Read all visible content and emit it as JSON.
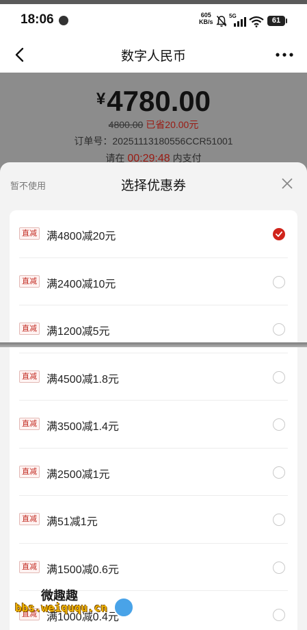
{
  "status_bar": {
    "time": "18:06",
    "net_speed_value": "605",
    "net_speed_unit": "KB/s",
    "signal_label": "5G",
    "battery": "61"
  },
  "nav": {
    "title": "数字人民币",
    "icons": [
      "back-arrow-icon",
      "more-dots-icon"
    ]
  },
  "payment": {
    "currency_symbol": "¥",
    "amount": "4780.00",
    "original_price": "4800.00",
    "saved_text": "已省20.00元",
    "order_label": "订单号：",
    "order_id": "20251113180556CCR51001",
    "countdown_prefix": "请在",
    "countdown": "00:29:48",
    "countdown_suffix": "内支付"
  },
  "coupon_sheet": {
    "skip_label": "暂不使用",
    "title": "选择优惠券",
    "close_icon": "close-icon",
    "tag_label": "直减",
    "coupons": [
      {
        "label": "满4800减20元",
        "selected": true
      },
      {
        "label": "满2400减10元",
        "selected": false
      },
      {
        "label": "满1200减5元",
        "selected": false
      },
      {
        "label": "满4500减1.8元",
        "selected": false
      },
      {
        "label": "满3500减1.4元",
        "selected": false
      },
      {
        "label": "满2500减1元",
        "selected": false
      },
      {
        "label": "满51减1元",
        "selected": false
      },
      {
        "label": "满1500减0.6元",
        "selected": false
      },
      {
        "label": "满1000减0.4元",
        "selected": false
      }
    ]
  },
  "watermark": {
    "top_text": "微趣趣",
    "url": "bbs.weiququ.cn"
  },
  "colors": {
    "accent_red": "#d0241b",
    "dim_overlay": "#8a8a8a"
  }
}
